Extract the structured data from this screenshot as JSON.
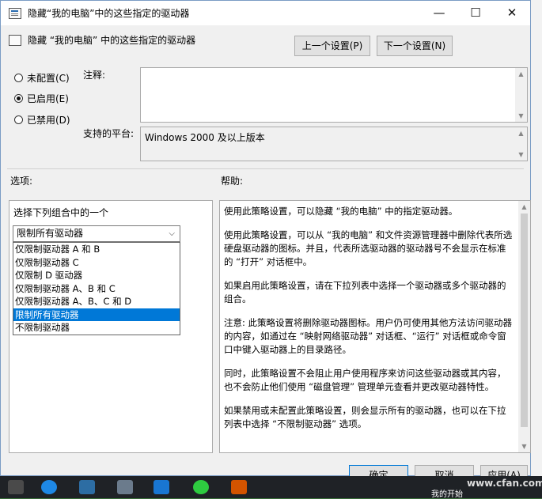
{
  "window": {
    "title": "隐藏“我的电脑”中的这些指定的驱动器",
    "minimize": "—",
    "maximize": "☐",
    "close": "✕"
  },
  "header": {
    "policy_name": "隐藏 “我的电脑” 中的这些指定的驱动器",
    "prev_button": "上一个设置(P)",
    "next_button": "下一个设置(N)"
  },
  "state": {
    "options": [
      {
        "label": "未配置(C)",
        "selected": false
      },
      {
        "label": "已启用(E)",
        "selected": true
      },
      {
        "label": "已禁用(D)",
        "selected": false
      }
    ]
  },
  "comment": {
    "label": "注释:",
    "value": ""
  },
  "platform": {
    "label": "支持的平台:",
    "value": "Windows 2000 及以上版本"
  },
  "options_section": {
    "label": "选项:",
    "prompt": "选择下列组合中的一个",
    "selected_value": "限制所有驱动器",
    "dropdown_items": [
      "仅限制驱动器 A 和 B",
      "仅限制驱动器 C",
      "仅限制 D 驱动器",
      "仅限制驱动器 A、B 和 C",
      "仅限制驱动器 A、B、C 和 D",
      "限制所有驱动器",
      "不限制驱动器"
    ],
    "highlighted_index": 5
  },
  "help": {
    "label": "帮助:",
    "paragraphs": [
      "使用此策略设置，可以隐藏 “我的电脑” 中的指定驱动器。",
      "使用此策略设置，可以从 “我的电脑” 和文件资源管理器中删除代表所选硬盘驱动器的图标。并且，代表所选驱动器的驱动器号不会显示在标准的 “打开” 对话框中。",
      "如果启用此策略设置，请在下拉列表中选择一个驱动器或多个驱动器的组合。",
      "注意: 此策略设置将删除驱动器图标。用户仍可使用其他方法访问驱动器的内容，如通过在 “映射网络驱动器” 对话框、“运行” 对话框或命令窗口中键入驱动器上的目录路径。",
      "同时，此策略设置不会阻止用户使用程序来访问这些驱动器或其内容，也不会防止他们使用 “磁盘管理” 管理单元查看并更改驱动器特性。",
      "如果禁用或未配置此策略设置，则会显示所有的驱动器，也可以在下拉列表中选择 “不限制驱动器” 选项。"
    ]
  },
  "footer": {
    "ok": "确定",
    "cancel": "取消",
    "apply": "应用(A)"
  },
  "taskbar": {
    "start_text": "我的开始",
    "watermark": "www.cfan.com.cn"
  }
}
